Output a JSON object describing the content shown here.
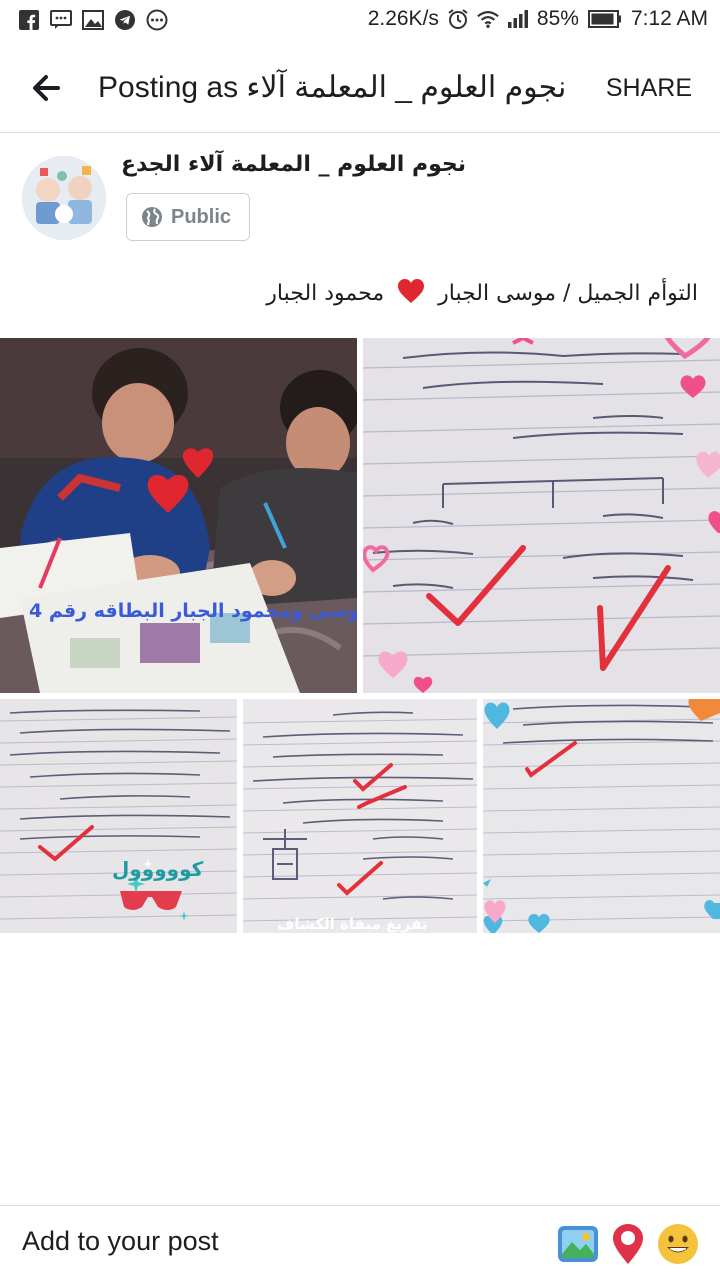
{
  "status_bar": {
    "network_speed": "2.26K/s",
    "battery": "85%",
    "time": "7:12 AM",
    "left_icons": [
      "facebook-icon",
      "message-icon",
      "gallery-icon",
      "telegram-icon",
      "more-dots-icon"
    ],
    "right_icons": [
      "alarm-icon",
      "wifi-icon",
      "signal-icon",
      "battery-icon"
    ]
  },
  "app_bar": {
    "title": "Posting as نجوم العلوم _ المعلمة آلاء...",
    "action": "SHARE"
  },
  "author": {
    "name": "نجوم العلوم _ المعلمة آلاء الجدع",
    "audience": "Public"
  },
  "post": {
    "caption_part1": "التوأم الجميل / موسى الجبار",
    "caption_part2": "محمود الجبار",
    "photos": [
      {
        "description": "photo-1",
        "overlay_text": "موسى ومحمود الجبار البطاقه رقم 4"
      },
      {
        "description": "photo-2",
        "notebook_text": "ان هناك نوعان من الشحنات الكهربائية"
      },
      {
        "description": "photo-3",
        "sticker_text": "كووووول"
      },
      {
        "description": "photo-4",
        "notebook_text": "تفريغ مبقاة الكشاف"
      },
      {
        "description": "photo-5"
      }
    ]
  },
  "composer": {
    "label": "Add to your post",
    "icons": [
      "photo-icon",
      "location-pin-icon",
      "emoji-icon"
    ]
  },
  "colors": {
    "text": "#1c1e21",
    "muted": "#7d848c",
    "divider": "#d9dbdf",
    "heart_red": "#e0262f",
    "check_red": "#e2313d",
    "pin_red": "#e0314a",
    "emoji_yellow": "#f5c33b",
    "overlay_blue": "#3b5bd6"
  }
}
